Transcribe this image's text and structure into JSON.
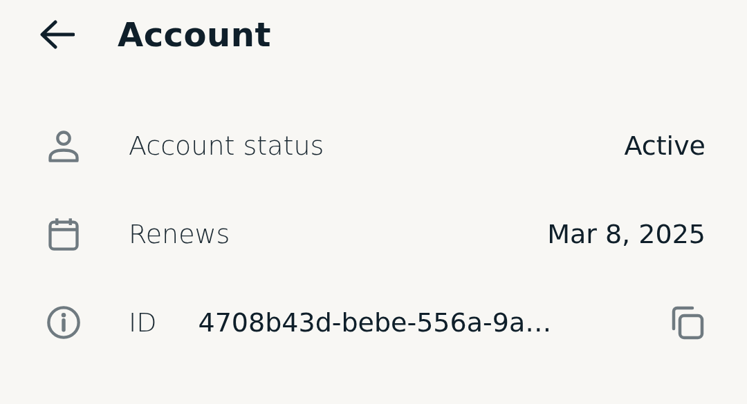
{
  "header": {
    "title": "Account"
  },
  "rows": [
    {
      "kind": "status",
      "label": "Account status",
      "value": "Active"
    },
    {
      "kind": "date",
      "label": "Renews",
      "value": "Mar 8, 2025"
    },
    {
      "kind": "id",
      "label": "ID",
      "value": "4708b43d-bebe-556a-9a…"
    }
  ]
}
